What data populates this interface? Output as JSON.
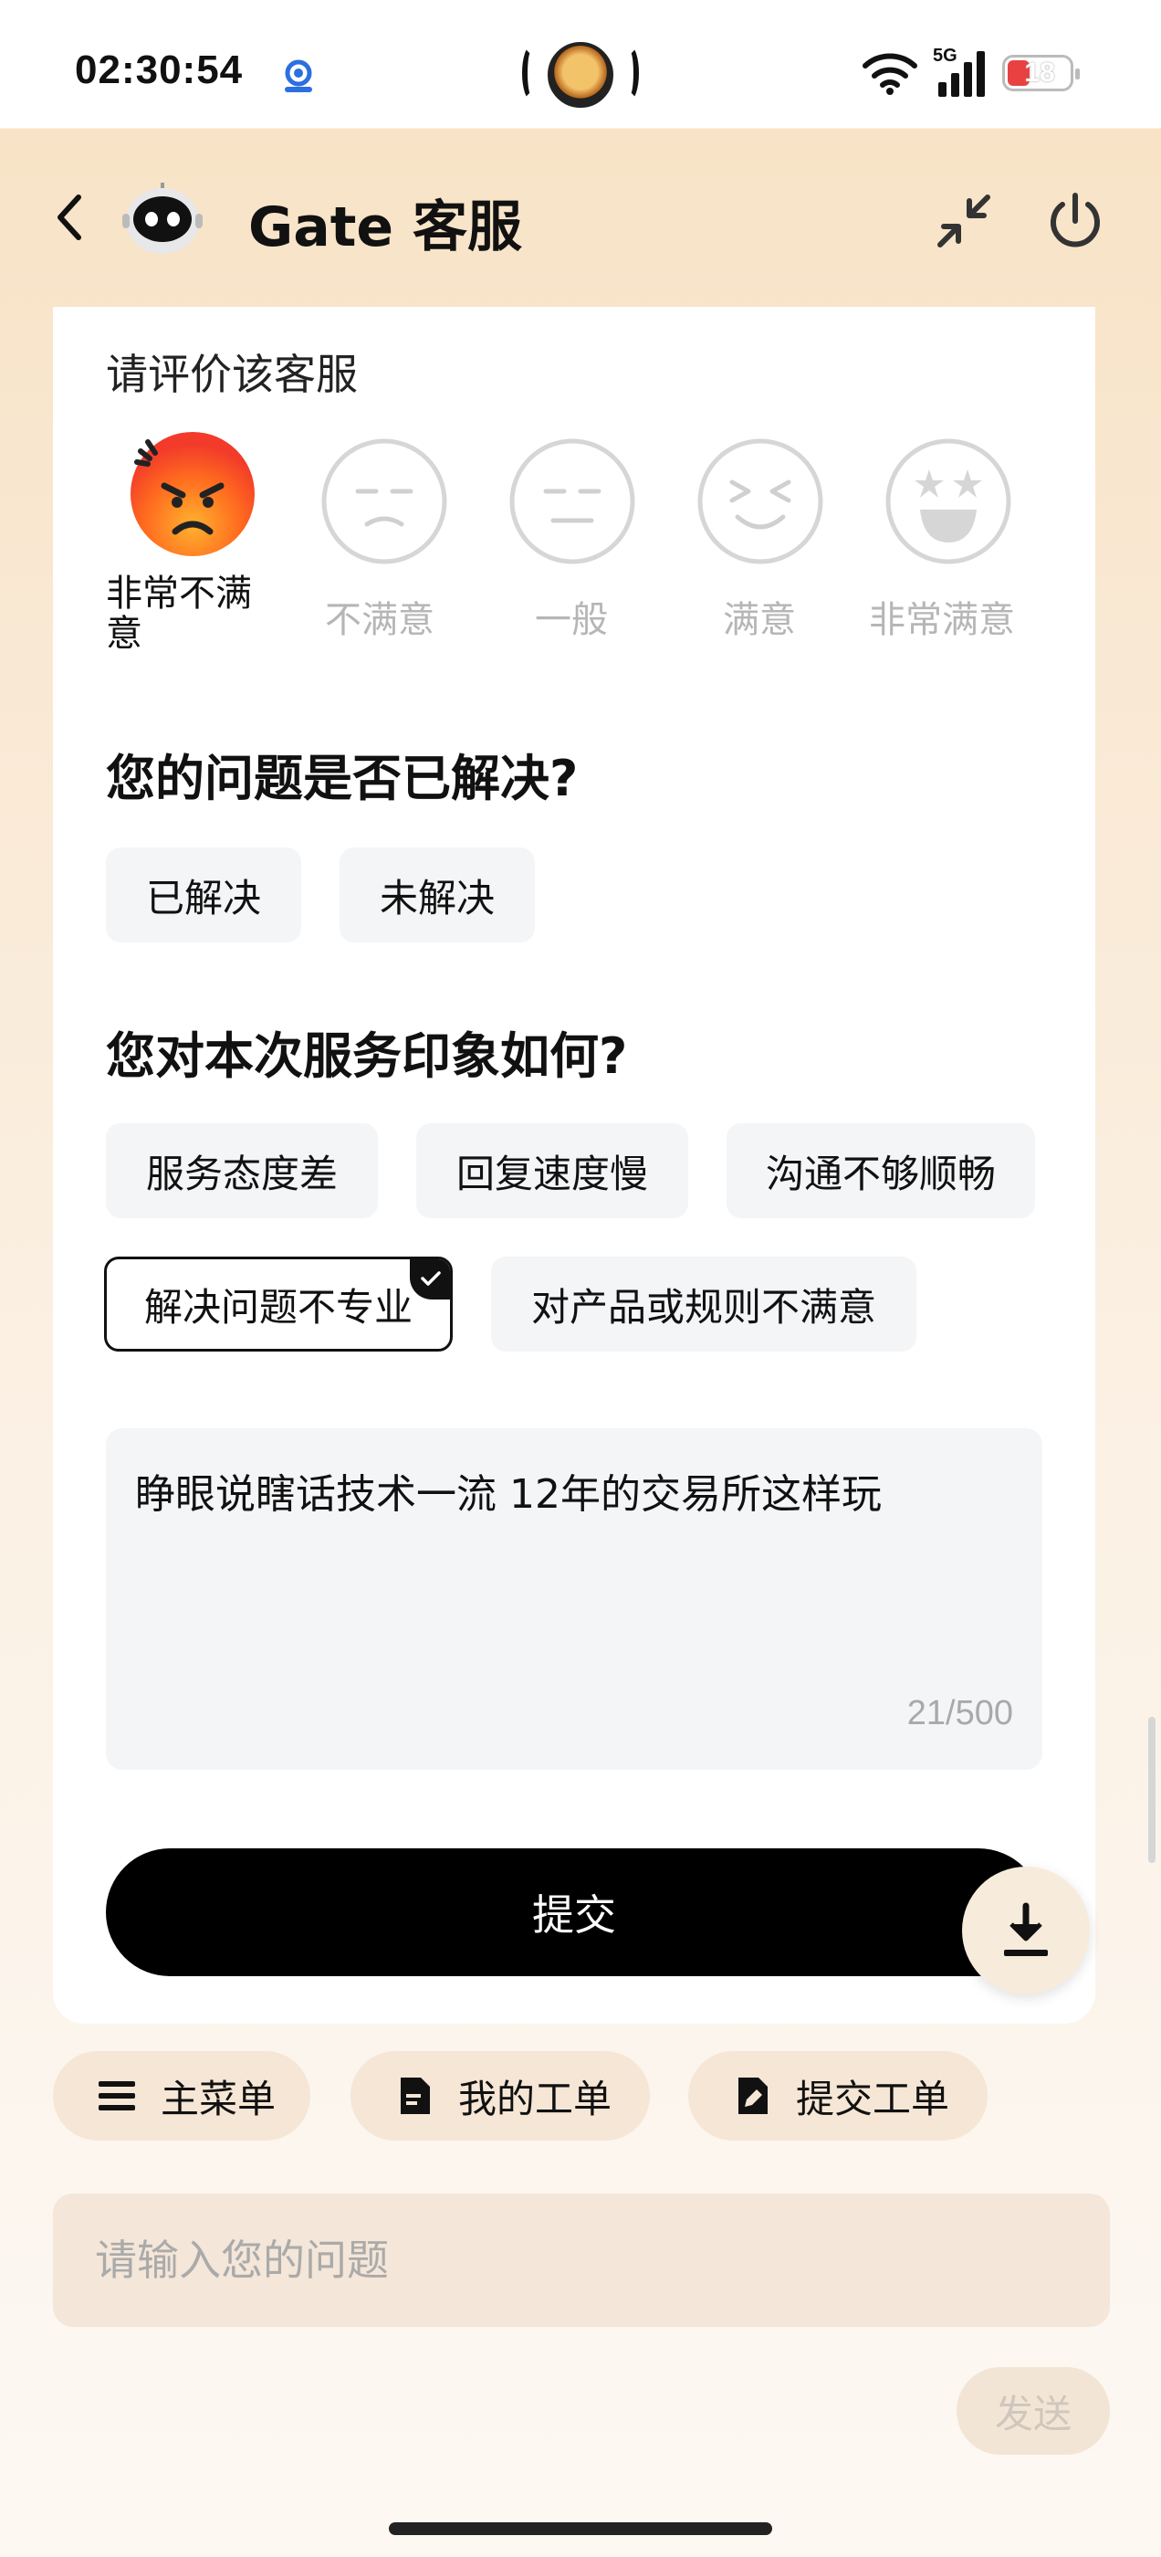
{
  "status_bar": {
    "time": "02:30:54",
    "network": "5G",
    "battery": "18",
    "icons": [
      "wifi-icon",
      "signal-icon",
      "battery-icon",
      "app-indicator-icon",
      "dynamic-island-icon"
    ]
  },
  "header": {
    "title": "Gate 客服",
    "icons": [
      "back-arrow-icon",
      "robot-avatar-icon",
      "minimize-icon",
      "power-icon"
    ]
  },
  "rating": {
    "title": "请评价该客服",
    "options": [
      {
        "label": "非常不满意",
        "icon": "angry-face-icon",
        "selected": true
      },
      {
        "label": "不满意",
        "icon": "unhappy-face-icon",
        "selected": false
      },
      {
        "label": "一般",
        "icon": "neutral-face-icon",
        "selected": false
      },
      {
        "label": "满意",
        "icon": "happy-face-icon",
        "selected": false
      },
      {
        "label": "非常满意",
        "icon": "star-eyes-face-icon",
        "selected": false
      }
    ]
  },
  "resolved": {
    "title": "您的问题是否已解决?",
    "options": [
      "已解决",
      "未解决"
    ]
  },
  "impression": {
    "title": "您对本次服务印象如何?",
    "options": [
      {
        "label": "服务态度差",
        "selected": false
      },
      {
        "label": "回复速度慢",
        "selected": false
      },
      {
        "label": "沟通不够顺畅",
        "selected": false
      },
      {
        "label": "解决问题不专业",
        "selected": true
      },
      {
        "label": "对产品或规则不满意",
        "selected": false
      }
    ]
  },
  "feedback": {
    "text": "睁眼说瞎话技术一流 12年的交易所这样玩",
    "count": "21/500"
  },
  "submit_label": "提交",
  "quick_actions": [
    {
      "label": "主菜单",
      "icon": "menu-icon"
    },
    {
      "label": "我的工单",
      "icon": "ticket-icon"
    },
    {
      "label": "提交工单",
      "icon": "edit-ticket-icon"
    }
  ],
  "chat_input": {
    "placeholder": "请输入您的问题"
  },
  "send_label": "发送",
  "colors": {
    "header_bg": "#f8e3c6",
    "primary_button": "#000000",
    "chip_bg": "#f4f5f7",
    "input_bg": "#f4e6d8",
    "quick_action_bg": "#f6e6d6"
  }
}
